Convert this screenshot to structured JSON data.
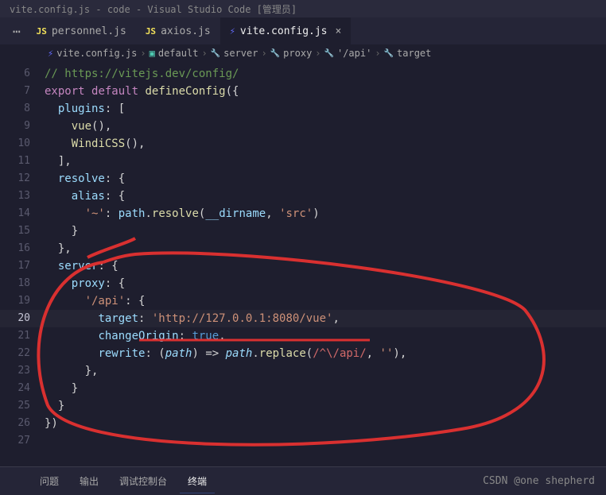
{
  "window": {
    "title": "vite.config.js - code - Visual Studio Code [管理员]"
  },
  "tabs": [
    {
      "icon": "JS",
      "label": "personnel.js",
      "active": false
    },
    {
      "icon": "JS",
      "label": "axios.js",
      "active": false
    },
    {
      "icon": "V",
      "label": "vite.config.js",
      "active": true
    }
  ],
  "breadcrumbs": [
    {
      "icon": "V",
      "label": "vite.config.js"
    },
    {
      "icon": "cube",
      "label": "default"
    },
    {
      "icon": "wrench",
      "label": "server"
    },
    {
      "icon": "wrench",
      "label": "proxy"
    },
    {
      "icon": "wrench",
      "label": "'/api'"
    },
    {
      "icon": "wrench",
      "label": "target"
    }
  ],
  "code": {
    "lines": [
      {
        "n": 6,
        "tokens": [
          [
            "comment",
            "// https://vitejs.dev/config/"
          ]
        ]
      },
      {
        "n": 7,
        "tokens": [
          [
            "export",
            "export"
          ],
          [
            "punct",
            " "
          ],
          [
            "keyword",
            "default"
          ],
          [
            "punct",
            " "
          ],
          [
            "func",
            "defineConfig"
          ],
          [
            "punct",
            "({"
          ]
        ]
      },
      {
        "n": 8,
        "tokens": [
          [
            "punct",
            "  "
          ],
          [
            "prop",
            "plugins"
          ],
          [
            "punct",
            ": ["
          ]
        ]
      },
      {
        "n": 9,
        "tokens": [
          [
            "punct",
            "    "
          ],
          [
            "func",
            "vue"
          ],
          [
            "punct",
            "(),"
          ]
        ]
      },
      {
        "n": 10,
        "tokens": [
          [
            "punct",
            "    "
          ],
          [
            "func",
            "WindiCSS"
          ],
          [
            "punct",
            "(),"
          ]
        ]
      },
      {
        "n": 11,
        "tokens": [
          [
            "punct",
            "  ],"
          ]
        ]
      },
      {
        "n": 12,
        "tokens": [
          [
            "punct",
            "  "
          ],
          [
            "prop",
            "resolve"
          ],
          [
            "punct",
            ": {"
          ]
        ]
      },
      {
        "n": 13,
        "tokens": [
          [
            "punct",
            "    "
          ],
          [
            "prop",
            "alias"
          ],
          [
            "punct",
            ": {"
          ]
        ]
      },
      {
        "n": 14,
        "tokens": [
          [
            "punct",
            "      "
          ],
          [
            "string",
            "'~'"
          ],
          [
            "punct",
            ": "
          ],
          [
            "var",
            "path"
          ],
          [
            "punct",
            "."
          ],
          [
            "func",
            "resolve"
          ],
          [
            "punct",
            "("
          ],
          [
            "var",
            "__dirname"
          ],
          [
            "punct",
            ", "
          ],
          [
            "string",
            "'src'"
          ],
          [
            "punct",
            ")"
          ]
        ]
      },
      {
        "n": 15,
        "tokens": [
          [
            "punct",
            "    }"
          ]
        ]
      },
      {
        "n": 16,
        "tokens": [
          [
            "punct",
            "  },"
          ]
        ]
      },
      {
        "n": 17,
        "tokens": [
          [
            "punct",
            "  "
          ],
          [
            "prop",
            "server"
          ],
          [
            "punct",
            ": {"
          ]
        ]
      },
      {
        "n": 18,
        "tokens": [
          [
            "punct",
            "    "
          ],
          [
            "prop",
            "proxy"
          ],
          [
            "punct",
            ": {"
          ]
        ]
      },
      {
        "n": 19,
        "tokens": [
          [
            "punct",
            "      "
          ],
          [
            "string",
            "'/api'"
          ],
          [
            "punct",
            ": {"
          ]
        ]
      },
      {
        "n": 20,
        "current": true,
        "tokens": [
          [
            "punct",
            "        "
          ],
          [
            "prop",
            "target"
          ],
          [
            "punct",
            ": "
          ],
          [
            "string",
            "'http://127.0.0.1:8080/vue'"
          ],
          [
            "punct",
            ","
          ]
        ]
      },
      {
        "n": 21,
        "tokens": [
          [
            "punct",
            "        "
          ],
          [
            "prop",
            "changeOrigin"
          ],
          [
            "punct",
            ": "
          ],
          [
            "bool",
            "true"
          ],
          [
            "punct",
            ","
          ]
        ]
      },
      {
        "n": 22,
        "tokens": [
          [
            "punct",
            "        "
          ],
          [
            "prop",
            "rewrite"
          ],
          [
            "punct",
            ": ("
          ],
          [
            "param",
            "path"
          ],
          [
            "punct",
            ") => "
          ],
          [
            "param",
            "path"
          ],
          [
            "punct",
            "."
          ],
          [
            "func",
            "replace"
          ],
          [
            "punct",
            "("
          ],
          [
            "regex",
            "/^\\/api/"
          ],
          [
            "punct",
            ", "
          ],
          [
            "string",
            "''"
          ],
          [
            "punct",
            "),"
          ]
        ]
      },
      {
        "n": 23,
        "tokens": [
          [
            "punct",
            "      },"
          ]
        ]
      },
      {
        "n": 24,
        "tokens": [
          [
            "punct",
            "    }"
          ]
        ]
      },
      {
        "n": 25,
        "tokens": [
          [
            "punct",
            "  }"
          ]
        ]
      },
      {
        "n": 26,
        "tokens": [
          [
            "punct",
            "})"
          ]
        ]
      },
      {
        "n": 27,
        "tokens": [
          [
            "punct",
            ""
          ]
        ]
      }
    ]
  },
  "panel": {
    "tabs": [
      "问题",
      "输出",
      "调试控制台",
      "终端"
    ],
    "active": 3
  },
  "watermark": "CSDN @one shepherd"
}
